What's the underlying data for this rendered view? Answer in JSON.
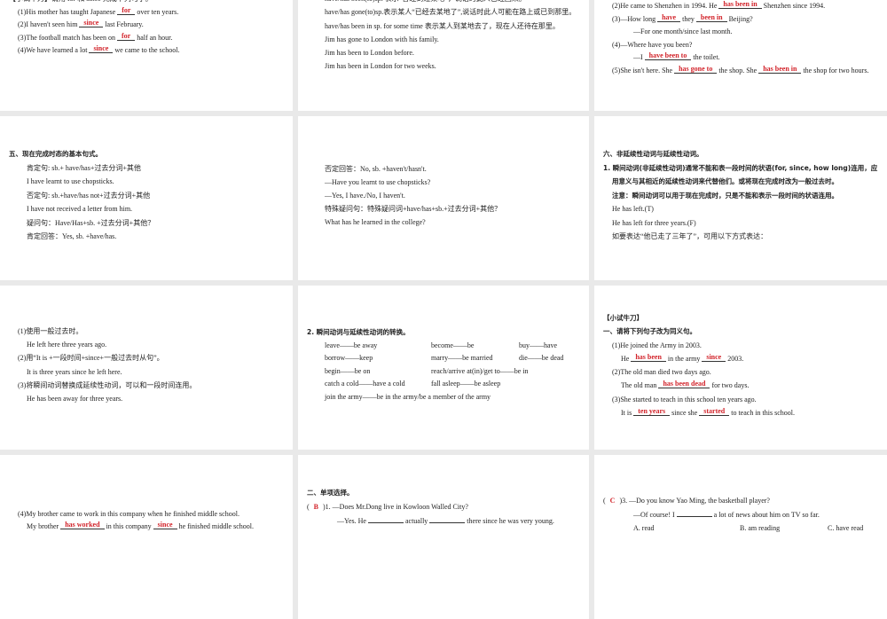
{
  "slides": [
    {
      "name": "slide-for-since-practice",
      "lines": [
        {
          "level": 0,
          "segs": [
            "【小试牛刀】请用 for 和 since 完成下列句子。"
          ]
        },
        {
          "level": 1,
          "segs": [
            "(1)His mother has taught Japanese ",
            {
              "ans": "for"
            },
            " over ten years."
          ]
        },
        {
          "level": 1,
          "segs": [
            "(2)I haven't seen him ",
            {
              "ans": "since"
            },
            " last February."
          ]
        },
        {
          "level": 1,
          "segs": [
            "(3)The football match has been on ",
            {
              "ans": "for"
            },
            " half an hour."
          ]
        },
        {
          "level": 1,
          "segs": [
            "(4)We have learned a lot ",
            {
              "ans": "since"
            },
            " we came to the school."
          ]
        }
      ]
    },
    {
      "name": "slide-been-gone",
      "lines": [
        {
          "level": 2,
          "segs": [
            "have/has been(to)sp.   表示“曾经到过某地”，说话时此人已经回来。"
          ]
        },
        {
          "level": 2,
          "segs": [
            "have/has gone(to)sp.表示某人“已经去某地了”,说话时此人可能在路上或已到那里。"
          ]
        },
        {
          "level": 2,
          "segs": [
            "have/has been in sp. for some time    表示某人到某地去了，现在人还待在那里。"
          ]
        },
        {
          "level": 2,
          "segs": [
            "Jim has gone to London with his family."
          ]
        },
        {
          "level": 2,
          "segs": [
            "Jim has been to London before."
          ]
        },
        {
          "level": 2,
          "segs": [
            "Jim has been in London for two weeks."
          ]
        }
      ]
    },
    {
      "name": "slide-been-gone-practice",
      "lines": [
        {
          "level": 1,
          "segs": [
            "(2)He came to Shenzhen in 1994.   He ",
            {
              "ans": "has been in"
            },
            " Shenzhen since 1994."
          ]
        },
        {
          "level": 1,
          "segs": [
            "(3)—How long ",
            {
              "ans": "have"
            },
            " they ",
            {
              "ans": "been in"
            },
            " Beijing?"
          ]
        },
        {
          "level": 3,
          "segs": [
            "—For one month/since last month."
          ]
        },
        {
          "level": 1,
          "segs": [
            "(4)—Where have you been?"
          ]
        },
        {
          "level": 3,
          "segs": [
            "—I ",
            {
              "ans": "have been to"
            },
            " the toilet."
          ]
        },
        {
          "level": 1,
          "segs": [
            "(5)She isn't here. She ",
            {
              "ans": "has gone to"
            },
            " the shop. She ",
            {
              "ans": "has been in"
            },
            " the shop for two hours."
          ]
        }
      ]
    },
    {
      "name": "slide-basic-patterns",
      "lines": [
        {
          "level": 0,
          "title": true,
          "segs": [
            "五、现在完成时态的基本句式。"
          ]
        },
        {
          "level": 2,
          "segs": [
            "肯定句: sb.+ have/has+过去分词+其他"
          ]
        },
        {
          "level": 2,
          "segs": [
            "I have learnt to use chopsticks."
          ]
        },
        {
          "level": 2,
          "segs": [
            "否定句: sb.+have/has not+过去分词+其他"
          ]
        },
        {
          "level": 2,
          "segs": [
            "I have not received a letter from him."
          ]
        },
        {
          "level": 2,
          "segs": [
            "疑问句：Have/Has+sb. +过去分词+其他？"
          ]
        },
        {
          "level": 2,
          "segs": [
            "肯定回答：Yes, sb. +have/has."
          ]
        }
      ]
    },
    {
      "name": "slide-basic-patterns-cont",
      "lines": [
        {
          "level": 2,
          "segs": [
            "否定回答：No, sb. +haven't/hasn't."
          ]
        },
        {
          "level": 2,
          "segs": [
            "—Have you learnt to use chopsticks?"
          ]
        },
        {
          "level": 2,
          "segs": [
            "—Yes, I have./No, I haven't."
          ]
        },
        {
          "level": 2,
          "segs": [
            "特殊疑问句：特殊疑问词+have/has+sb.+过去分词+其他？"
          ]
        },
        {
          "level": 2,
          "segs": [
            "What has he learned in the college?"
          ]
        }
      ]
    },
    {
      "name": "slide-verb-types",
      "lines": [
        {
          "level": 0,
          "title": true,
          "segs": [
            "六、非延续性动词与延续性动词。"
          ]
        },
        {
          "level": 0,
          "title": true,
          "segs": [
            "1. 瞬间动词(非延续性动词)通常不能和表一段时间的状语(for, since, how long)连用，应"
          ]
        },
        {
          "level": 1,
          "title": true,
          "segs": [
            "用意义与其相近的延续性动词来代替他们。或将现在完成时改为一般过去时。"
          ]
        },
        {
          "level": 1,
          "title": true,
          "segs": [
            "注意：瞬间动词可以用于现在完成时，只是不能和表示一段时间的状语连用。"
          ]
        },
        {
          "level": 1,
          "segs": [
            "He has left.(T)"
          ]
        },
        {
          "level": 1,
          "segs": [
            "He has left for three years.(F)"
          ]
        },
        {
          "level": 1,
          "segs": [
            "如要表达“他已走了三年了”，可用以下方式表达："
          ]
        }
      ]
    },
    {
      "name": "slide-alternatives",
      "lines": [
        {
          "level": 1,
          "segs": [
            "(1)使用一般过去时。"
          ]
        },
        {
          "level": 2,
          "segs": [
            "He left here three years ago."
          ]
        },
        {
          "level": 1,
          "segs": [
            "(2)用“It is +一段时间+since+一般过去时从句”。"
          ]
        },
        {
          "level": 2,
          "segs": [
            "It is three years since he left here."
          ]
        },
        {
          "level": 1,
          "segs": [
            "(3)将瞬间动词替换成延续性动词，可以和一段时间连用。"
          ]
        },
        {
          "level": 2,
          "segs": [
            "He has been away for three years."
          ]
        }
      ]
    },
    {
      "name": "slide-verb-conversion",
      "lines": [
        {
          "level": 0,
          "title": true,
          "segs": [
            "2. 瞬间动词与延续性动词的转换。"
          ]
        },
        {
          "level": 2,
          "cols": [
            "leave——be away",
            "become——be",
            "buy——have"
          ]
        },
        {
          "level": 2,
          "cols": [
            "borrow——keep",
            "marry——be married",
            "die——be dead"
          ]
        },
        {
          "level": 2,
          "cols": [
            "begin——be on",
            "reach/arrive at(in)/get to——be in"
          ]
        },
        {
          "level": 2,
          "cols": [
            "catch a cold——have a cold",
            "fall asleep——be asleep"
          ]
        },
        {
          "level": 2,
          "segs": [
            "join the army——be in the army/be a member of the army"
          ]
        }
      ]
    },
    {
      "name": "slide-rewrite-practice",
      "lines": [
        {
          "level": 0,
          "title": true,
          "segs": [
            "【小试牛刀】"
          ]
        },
        {
          "level": 0,
          "title": true,
          "segs": [
            "一、请将下列句子改为同义句。"
          ]
        },
        {
          "level": 1,
          "segs": [
            "(1)He joined the Army in 2003."
          ]
        },
        {
          "level": 2,
          "segs": [
            "He ",
            {
              "ans": "has been"
            },
            " in the army ",
            {
              "ans": "since"
            },
            " 2003."
          ]
        },
        {
          "level": 1,
          "segs": [
            "(2)The old man died two days ago."
          ]
        },
        {
          "level": 2,
          "segs": [
            "The old man ",
            {
              "ans": "has been dead"
            },
            " for two days."
          ]
        },
        {
          "level": 1,
          "segs": [
            "(3)She started to teach in this school ten years ago."
          ]
        },
        {
          "level": 2,
          "segs": [
            "It is ",
            {
              "ans": "ten years"
            },
            " since she ",
            {
              "ans": "started"
            },
            " to teach in this school."
          ]
        }
      ]
    },
    {
      "name": "slide-rewrite-practice-cont",
      "lines": [
        {
          "level": 1,
          "segs": [
            "(4)My brother came to work in this company when he finished middle school."
          ]
        },
        {
          "level": 2,
          "segs": [
            "My brother ",
            {
              "ans": "has worked"
            },
            " in this company ",
            {
              "ans": "since"
            },
            " he finished middle school."
          ]
        }
      ]
    },
    {
      "name": "slide-multiple-choice",
      "lines": [
        {
          "level": 0,
          "title": true,
          "segs": [
            "二、单项选择。"
          ]
        },
        {
          "level": 0,
          "segs": [
            "( ",
            {
              "choice": "B"
            },
            " )1.  —Does Mr.Dong live in Kowloon Walled City?"
          ]
        },
        {
          "level": 3,
          "segs": [
            "—Yes. He ",
            {
              "blank": true
            },
            " actually ",
            {
              "blank": true
            },
            " there since he was very young."
          ]
        }
      ]
    },
    {
      "name": "slide-multiple-choice-cont",
      "lines": [
        {
          "level": 0,
          "segs": [
            "( ",
            {
              "choice": "C"
            },
            " )3.  —Do you know Yao Ming, the basketball player?"
          ]
        },
        {
          "level": 3,
          "segs": [
            "—Of course! I ",
            {
              "blank": true
            },
            " a lot of news about him on TV so far."
          ]
        },
        {
          "level": 3,
          "cols": [
            "A. read",
            "B. am reading",
            "C. have read"
          ]
        }
      ]
    }
  ]
}
